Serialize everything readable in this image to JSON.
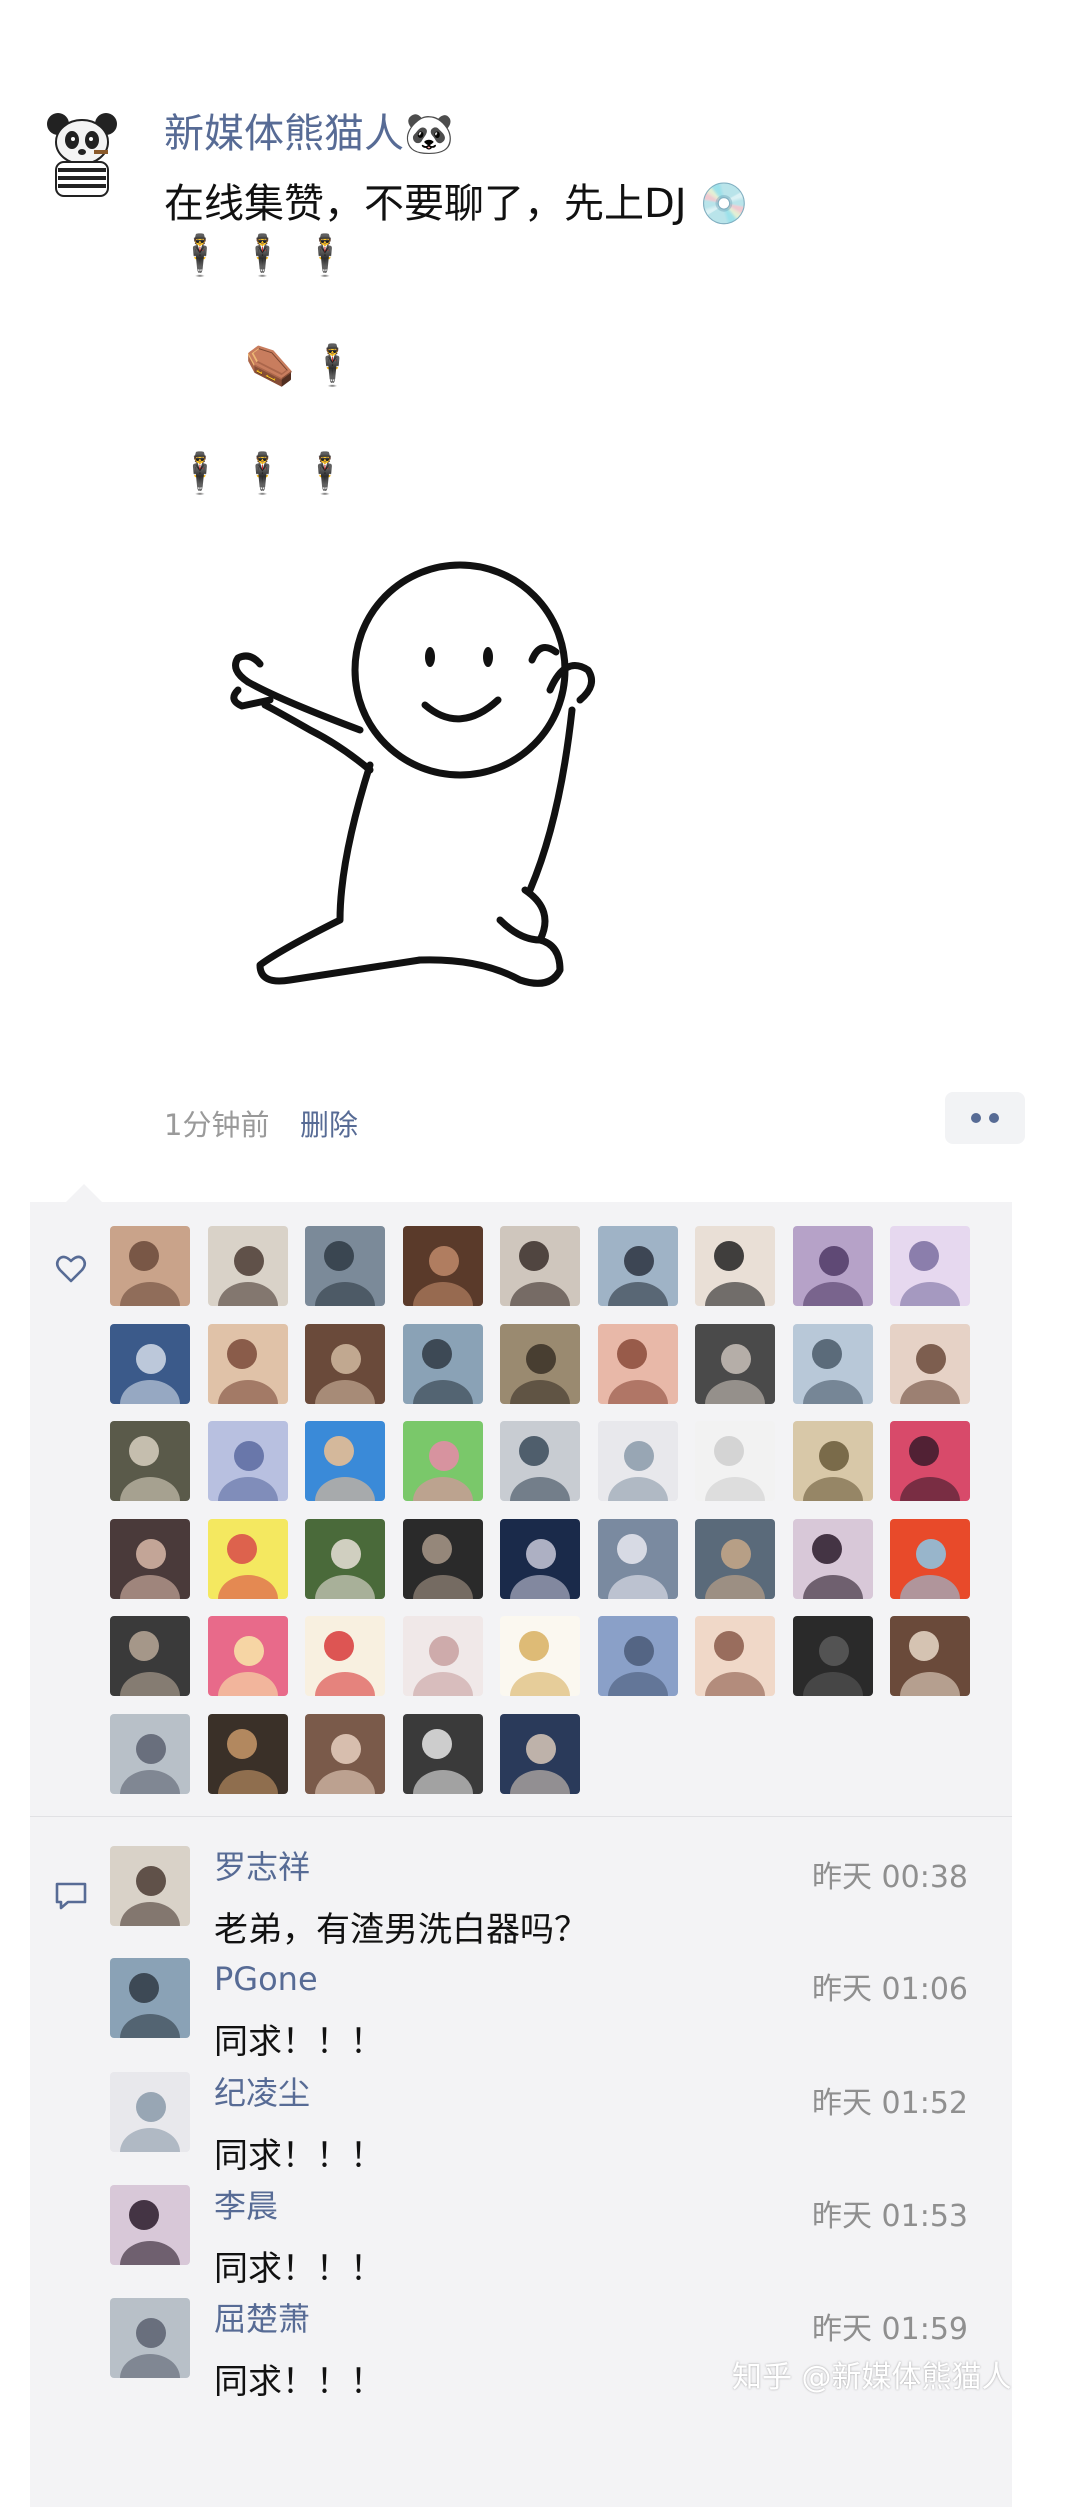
{
  "post": {
    "author_name": "新媒体熊猫人🐼",
    "text": "在线集赞，不要聊了，先上DJ 💿",
    "emoji_lines": [
      "🕴  🕴  🕴",
      "⚰️  🕴",
      "🕴  🕴  🕴"
    ],
    "time": "1分钟前",
    "delete_label": "删除",
    "more_icon": "more-dots-icon"
  },
  "likes": {
    "icon": "heart-outline-icon",
    "avatar_count": 50
  },
  "comments": {
    "icon": "comment-bubble-icon",
    "items": [
      {
        "name": "罗志祥",
        "time": "昨天 00:38",
        "text": "老弟，有渣男洗白器吗？"
      },
      {
        "name": "PGone",
        "time": "昨天 01:06",
        "text": "同求！！！"
      },
      {
        "name": "纪凌尘",
        "time": "昨天 01:52",
        "text": "同求！！！"
      },
      {
        "name": "李晨",
        "time": "昨天 01:53",
        "text": "同求！！！"
      },
      {
        "name": "屈楚萧",
        "time": "昨天 01:59",
        "text": "同求！！！"
      }
    ]
  },
  "watermark": "知乎 @新媒体熊猫人",
  "colors": {
    "name_blue": "#576b95",
    "panel_bg": "#f3f3f5",
    "secondary_text": "#9a9a9a"
  }
}
